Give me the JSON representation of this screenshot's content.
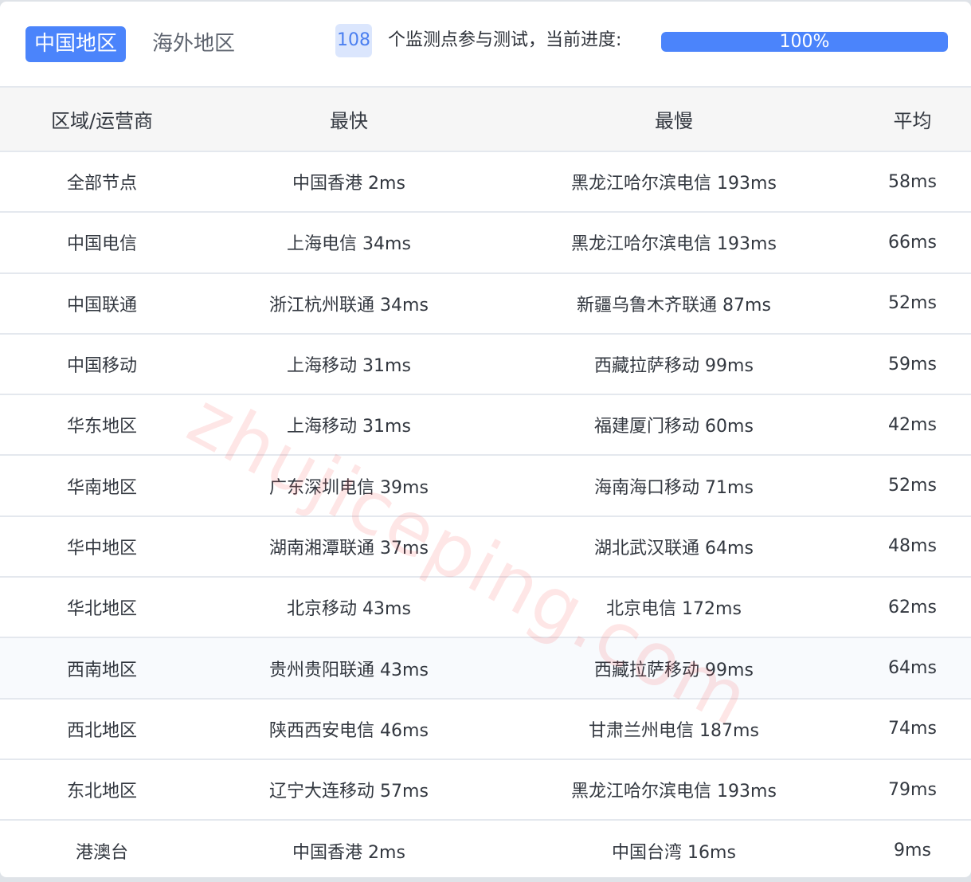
{
  "tabs": [
    {
      "label": "中国地区",
      "active": true
    },
    {
      "label": "海外地区",
      "active": false
    }
  ],
  "status": {
    "node_count": "108",
    "text": "个监测点参与测试，当前进度:",
    "progress_percent": 100,
    "progress_label": "100%"
  },
  "colors": {
    "accent": "#4b84fb",
    "badge_bg": "#dbe6fd",
    "watermark": "#fa5050"
  },
  "table": {
    "headers": [
      "区域/运营商",
      "最快",
      "最慢",
      "平均"
    ],
    "rows": [
      {
        "region": "全部节点",
        "fastest": "中国香港 2ms",
        "slowest": "黑龙江哈尔滨电信 193ms",
        "average": "58ms"
      },
      {
        "region": "中国电信",
        "fastest": "上海电信 34ms",
        "slowest": "黑龙江哈尔滨电信 193ms",
        "average": "66ms"
      },
      {
        "region": "中国联通",
        "fastest": "浙江杭州联通 34ms",
        "slowest": "新疆乌鲁木齐联通 87ms",
        "average": "52ms"
      },
      {
        "region": "中国移动",
        "fastest": "上海移动 31ms",
        "slowest": "西藏拉萨移动 99ms",
        "average": "59ms"
      },
      {
        "region": "华东地区",
        "fastest": "上海移动 31ms",
        "slowest": "福建厦门移动 60ms",
        "average": "42ms"
      },
      {
        "region": "华南地区",
        "fastest": "广东深圳电信 39ms",
        "slowest": "海南海口移动 71ms",
        "average": "52ms"
      },
      {
        "region": "华中地区",
        "fastest": "湖南湘潭联通 37ms",
        "slowest": "湖北武汉联通 64ms",
        "average": "48ms"
      },
      {
        "region": "华北地区",
        "fastest": "北京移动 43ms",
        "slowest": "北京电信 172ms",
        "average": "62ms"
      },
      {
        "region": "西南地区",
        "fastest": "贵州贵阳联通 43ms",
        "slowest": "西藏拉萨移动 99ms",
        "average": "64ms"
      },
      {
        "region": "西北地区",
        "fastest": "陕西西安电信 46ms",
        "slowest": "甘肃兰州电信 187ms",
        "average": "74ms"
      },
      {
        "region": "东北地区",
        "fastest": "辽宁大连移动 57ms",
        "slowest": "黑龙江哈尔滨电信 193ms",
        "average": "79ms"
      },
      {
        "region": "港澳台",
        "fastest": "中国香港 2ms",
        "slowest": "中国台湾 16ms",
        "average": "9ms"
      }
    ],
    "hovered_row_index": 8
  },
  "watermark": "zhujiceping.com"
}
